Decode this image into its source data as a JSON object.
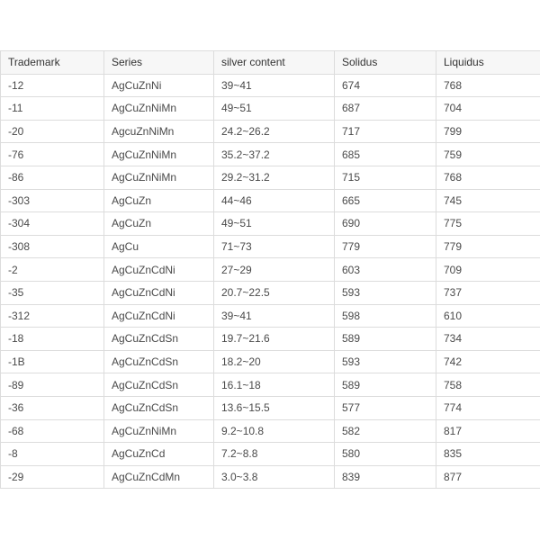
{
  "table": {
    "columns": [
      "Trademark",
      "Series",
      "silver content",
      "Solidus",
      "Liquidus"
    ],
    "rows": [
      [
        "-12",
        "AgCuZnNi",
        "39~41",
        "674",
        "768"
      ],
      [
        "-11",
        "AgCuZnNiMn",
        "49~51",
        "687",
        "704"
      ],
      [
        "-20",
        "AgcuZnNiMn",
        "24.2~26.2",
        "717",
        "799"
      ],
      [
        "-76",
        "AgCuZnNiMn",
        "35.2~37.2",
        "685",
        "759"
      ],
      [
        "-86",
        "AgCuZnNiMn",
        "29.2~31.2",
        "715",
        "768"
      ],
      [
        "-303",
        "AgCuZn",
        "44~46",
        "665",
        "745"
      ],
      [
        "-304",
        "AgCuZn",
        "49~51",
        "690",
        "775"
      ],
      [
        "-308",
        "AgCu",
        "71~73",
        "779",
        "779"
      ],
      [
        "-2",
        "AgCuZnCdNi",
        "27~29",
        "603",
        "709"
      ],
      [
        "-35",
        "AgCuZnCdNi",
        "20.7~22.5",
        "593",
        "737"
      ],
      [
        "-312",
        "AgCuZnCdNi",
        "39~41",
        "598",
        "610"
      ],
      [
        "-18",
        "AgCuZnCdSn",
        "19.7~21.6",
        "589",
        "734"
      ],
      [
        "-1B",
        "AgCuZnCdSn",
        "18.2~20",
        "593",
        "742"
      ],
      [
        "-89",
        "AgCuZnCdSn",
        "16.1~18",
        "589",
        "758"
      ],
      [
        "-36",
        "AgCuZnCdSn",
        "13.6~15.5",
        "577",
        "774"
      ],
      [
        "-68",
        "AgCuZnNiMn",
        "9.2~10.8",
        "582",
        "817"
      ],
      [
        "-8",
        "AgCuZnCd",
        "7.2~8.8",
        "580",
        "835"
      ],
      [
        "-29",
        "AgCuZnCdMn",
        "3.0~3.8",
        "839",
        "877"
      ]
    ]
  }
}
